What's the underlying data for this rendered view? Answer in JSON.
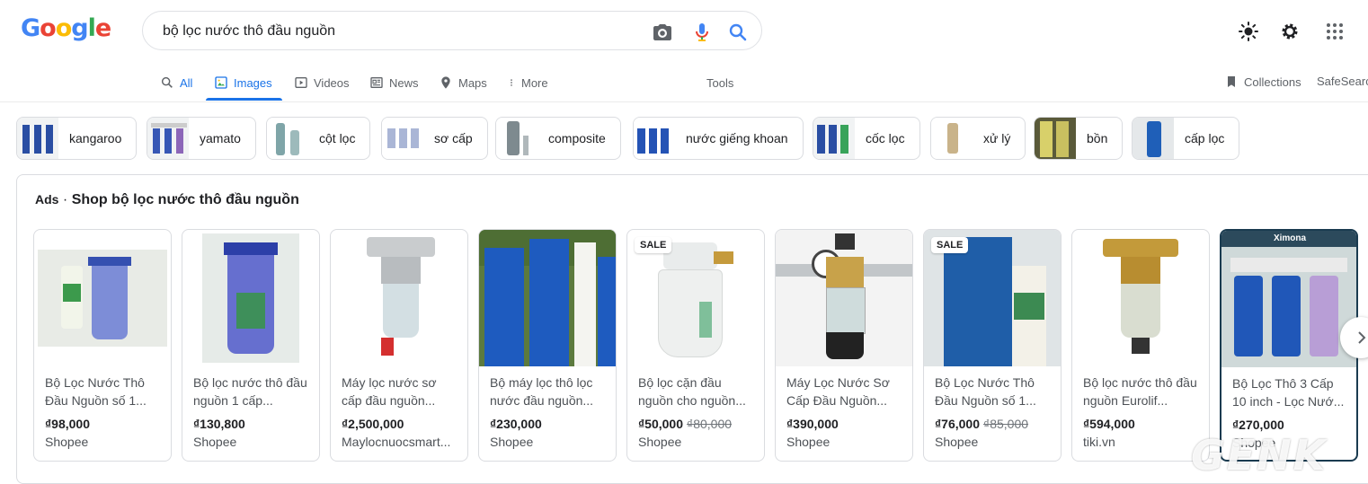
{
  "logo": {
    "letters": [
      "G",
      "o",
      "o",
      "g",
      "l",
      "e"
    ],
    "colors": [
      "#4285f4",
      "#ea4335",
      "#fbbc05",
      "#4285f4",
      "#34a853",
      "#ea4335"
    ]
  },
  "search": {
    "query": "bộ lọc nước thô đầu nguồn"
  },
  "tabs": [
    {
      "label": "All",
      "icon": "search-icon"
    },
    {
      "label": "Images",
      "icon": "image-icon"
    },
    {
      "label": "Videos",
      "icon": "play-icon"
    },
    {
      "label": "News",
      "icon": "news-icon"
    },
    {
      "label": "Maps",
      "icon": "pin-icon"
    },
    {
      "label": "More",
      "icon": "more-vert-icon"
    }
  ],
  "tools_label": "Tools",
  "collections_label": "Collections",
  "safesearch_label": "SafeSearch",
  "chips": [
    "kangaroo",
    "yamato",
    "cột lọc",
    "sơ cấp",
    "composite",
    "nước giếng khoan",
    "cốc lọc",
    "xử lý",
    "bồn",
    "cấp lọc"
  ],
  "ads": {
    "tag": "Ads",
    "sep": "·",
    "title": "Shop bộ lọc nước thô đầu nguồn"
  },
  "products": [
    {
      "title": "Bộ Lọc Nước Thô Đầu Nguồn số 1...",
      "price": "₫98,000",
      "old_price": "",
      "store": "Shopee",
      "sale": ""
    },
    {
      "title": "Bộ lọc nước thô đầu nguồn 1 cấp...",
      "price": "₫130,800",
      "old_price": "",
      "store": "Shopee",
      "sale": ""
    },
    {
      "title": "Máy lọc nước sơ cấp đầu nguồn...",
      "price": "₫2,500,000",
      "old_price": "",
      "store": "Maylocnuocsmart...",
      "sale": ""
    },
    {
      "title": "Bộ máy lọc thô lọc nước đầu nguồn...",
      "price": "₫230,000",
      "old_price": "",
      "store": "Shopee",
      "sale": ""
    },
    {
      "title": "Bộ lọc cặn đầu nguồn cho nguồn...",
      "price": "₫50,000",
      "old_price": "₫80,000",
      "store": "Shopee",
      "sale": "SALE"
    },
    {
      "title": "Máy Lọc Nước Sơ Cấp Đầu Nguồn...",
      "price": "₫390,000",
      "old_price": "",
      "store": "Shopee",
      "sale": ""
    },
    {
      "title": "Bộ Lọc Nước Thô Đầu Nguồn số 1...",
      "price": "₫76,000",
      "old_price": "₫85,000",
      "store": "Shopee",
      "sale": "SALE"
    },
    {
      "title": "Bộ lọc nước thô đầu nguồn Eurolif...",
      "price": "₫594,000",
      "old_price": "",
      "store": "tiki.vn",
      "sale": ""
    },
    {
      "title": "Bộ Lọc Thô 3 Cấp 10 inch - Lọc Nướ...",
      "price": "₫270,000",
      "old_price": "",
      "store": "Shopee",
      "sale": "",
      "brand": "Ximona"
    }
  ],
  "watermark": "GENK"
}
